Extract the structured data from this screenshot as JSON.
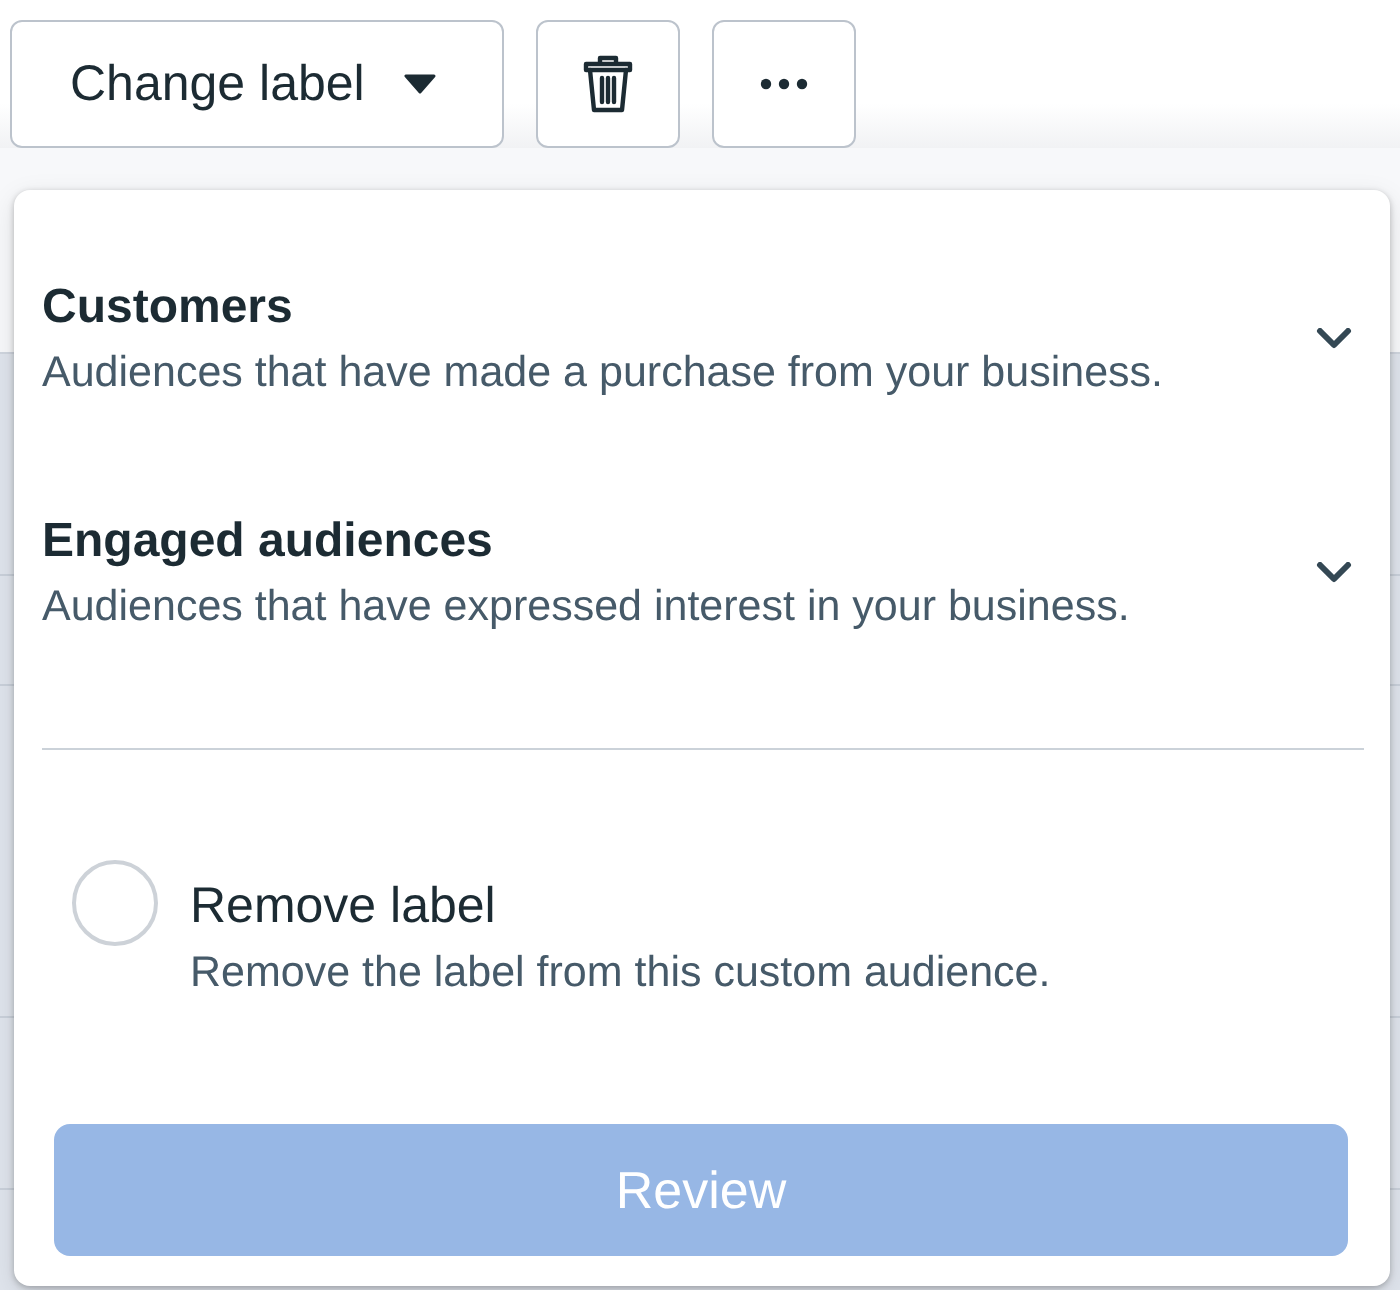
{
  "toolbar": {
    "change_label_button": {
      "label": "Change label"
    },
    "icon_buttons": [
      {
        "kind": "delete"
      },
      {
        "kind": "more"
      }
    ]
  },
  "label_menu": {
    "categories": [
      {
        "title": "Customers",
        "description": "Audiences that have made a purchase from your business.",
        "expanded": false
      },
      {
        "title": "Engaged audiences",
        "description": "Audiences that have expressed interest in your business.",
        "expanded": false
      }
    ],
    "remove_option": {
      "label": "Remove label",
      "description": "Remove the label from this custom audience.",
      "selected": false
    },
    "review_button": {
      "label": "Review",
      "disabled": true
    }
  }
}
